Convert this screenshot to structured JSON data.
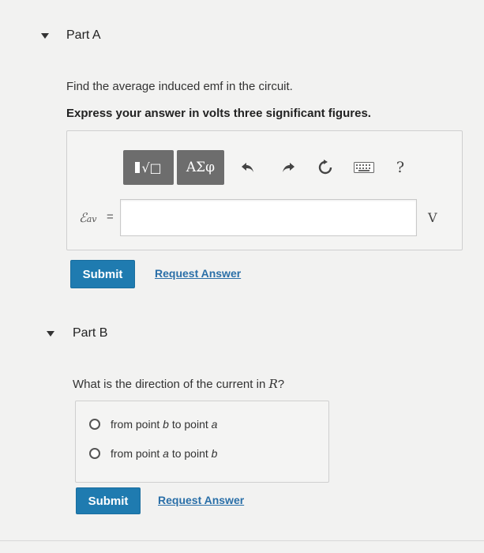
{
  "partA": {
    "title": "Part A",
    "prompt": "Find the average induced emf in the circuit.",
    "instruction": "Express your answer in volts three significant figures.",
    "toolbar": {
      "templates_label": "√□",
      "greek_label": "ΑΣφ",
      "help_label": "?"
    },
    "answer": {
      "variable": "ℰ",
      "subscript": "av",
      "equals": "=",
      "value": "",
      "unit": "V"
    },
    "submit_label": "Submit",
    "request_answer_label": "Request Answer"
  },
  "partB": {
    "title": "Part B",
    "question_prefix": "What is the direction of the current in ",
    "question_var": "R",
    "question_suffix": "?",
    "options": [
      {
        "pre": "from point ",
        "p1": "b",
        "mid": " to point ",
        "p2": "a"
      },
      {
        "pre": "from point ",
        "p1": "a",
        "mid": " to point ",
        "p2": "b"
      }
    ],
    "submit_label": "Submit",
    "request_answer_label": "Request Answer"
  }
}
